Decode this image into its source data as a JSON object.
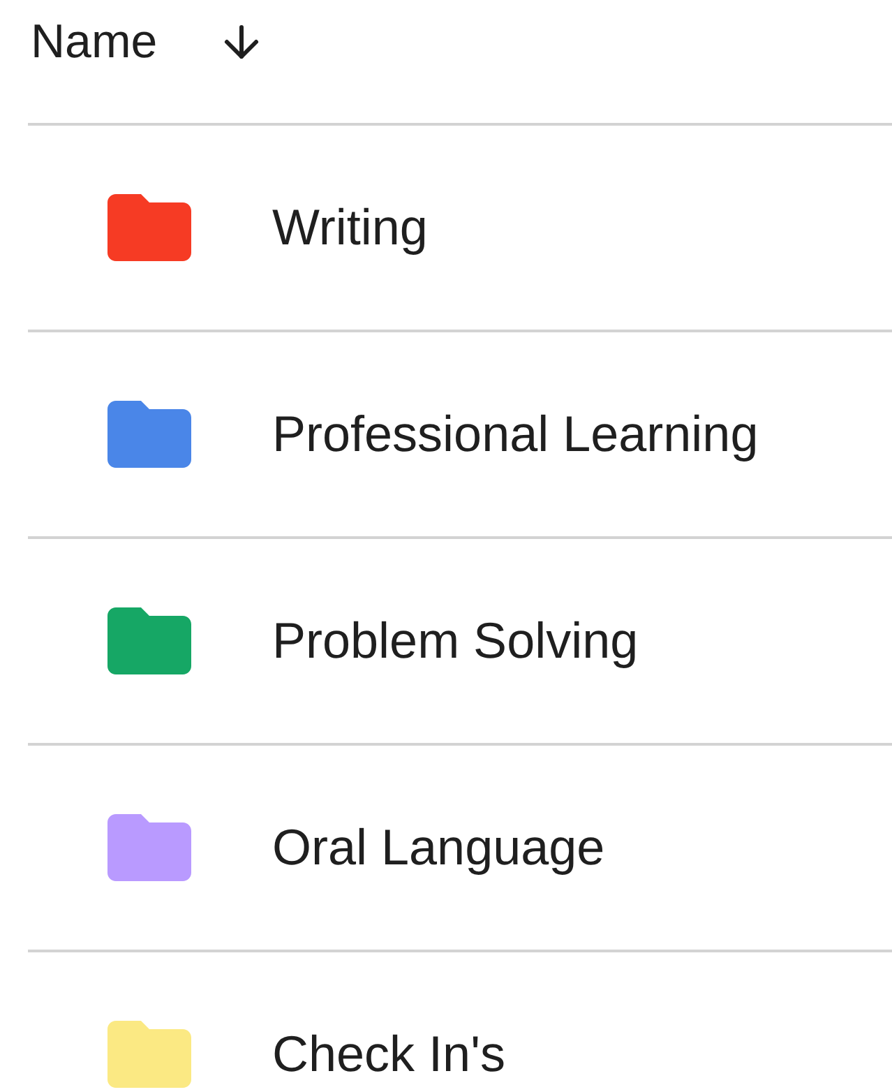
{
  "header": {
    "label": "Name",
    "descending": true
  },
  "folders": [
    {
      "name": "Writing",
      "color": "#f63b24"
    },
    {
      "name": "Professional Learning",
      "color": "#4a86e8"
    },
    {
      "name": "Problem Solving",
      "color": "#16a765"
    },
    {
      "name": "Oral Language",
      "color": "#b99aff"
    },
    {
      "name": "Check In's",
      "color": "#fbe983"
    }
  ]
}
